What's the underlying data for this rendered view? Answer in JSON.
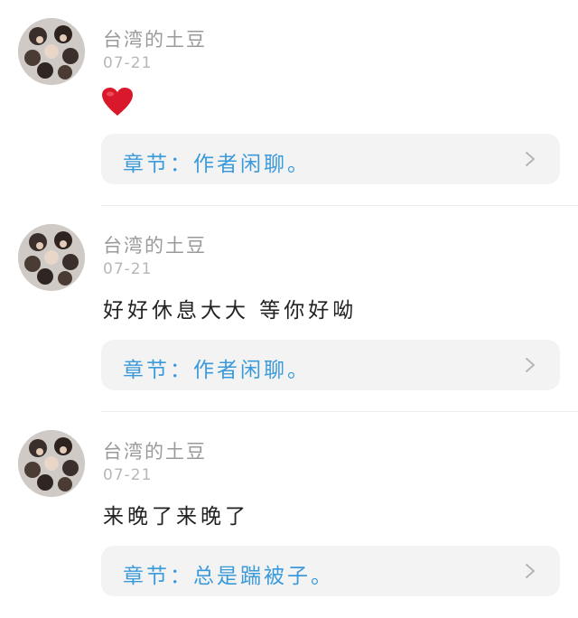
{
  "comments": [
    {
      "username": "台湾的土豆",
      "date": "07-21",
      "text": "",
      "emoji": "heart-icon",
      "chapter_label": "章节：作者闲聊。"
    },
    {
      "username": "台湾的土豆",
      "date": "07-21",
      "text": "好好休息大大 等你好呦",
      "emoji": "",
      "chapter_label": "章节：作者闲聊。"
    },
    {
      "username": "台湾的土豆",
      "date": "07-21",
      "text": "来晚了来晚了",
      "emoji": "",
      "chapter_label": "章节：总是踹被子。"
    }
  ],
  "colors": {
    "chapter_text": "#3b9ad9",
    "card_bg": "#f3f3f3",
    "username": "#9a9a9a",
    "date": "#b7b7b7",
    "heart": "#d9192b"
  }
}
